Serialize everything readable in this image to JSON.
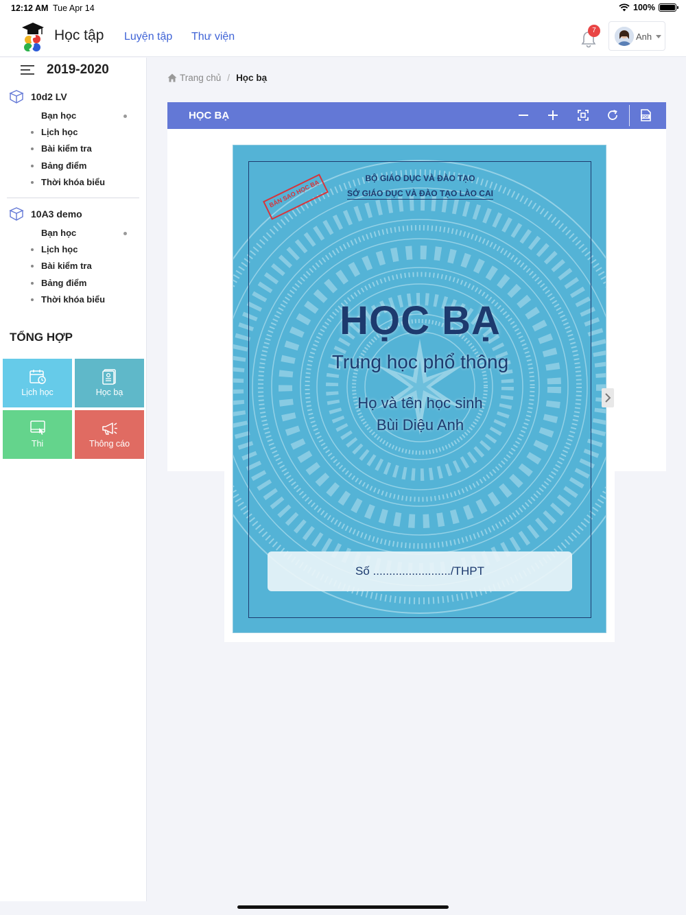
{
  "status_bar": {
    "time": "12:12 AM",
    "date": "Tue Apr 14",
    "battery": "100%"
  },
  "header": {
    "app_title": "Học tập",
    "nav": [
      "Luyện tập",
      "Thư viện"
    ],
    "notification_count": "7",
    "user_name": "Anh"
  },
  "sidebar": {
    "year": "2019-2020",
    "classes": [
      {
        "name": "10d2 LV",
        "items": [
          "Bạn học",
          "Lịch học",
          "Bài kiểm tra",
          "Bảng điểm",
          "Thời khóa biểu"
        ]
      },
      {
        "name": "10A3 demo",
        "items": [
          "Bạn học",
          "Lịch học",
          "Bài kiểm tra",
          "Bảng điểm",
          "Thời khóa biểu"
        ]
      }
    ],
    "summary_title": "TỔNG HỢP",
    "tiles": [
      {
        "label": "Lịch học",
        "color": "#66cbe9"
      },
      {
        "label": "Học bạ",
        "color": "#5fb8c9"
      },
      {
        "label": "Thi",
        "color": "#64d48c"
      },
      {
        "label": "Thông cáo",
        "color": "#e06b62"
      }
    ]
  },
  "breadcrumb": {
    "home": "Trang chủ",
    "current": "Học bạ"
  },
  "panel": {
    "title": "HỌC BẠ",
    "toolbar": [
      "zoom-out-icon",
      "zoom-in-icon",
      "fit-screen-icon",
      "rotate-icon",
      "pdf-icon"
    ]
  },
  "cover": {
    "ministry": "BỘ GIÁO DỤC VÀ ĐÀO TẠO",
    "department": "SỞ GIÁO DỤC VÀ ĐÀO TẠO LÀO CAI",
    "stamp": "BẢN SAO HỌC BẠ",
    "title": "HỌC BẠ",
    "subtitle": "Trung học phổ thông",
    "name_label": "Họ và tên học sinh",
    "student_name": "Bùi Diệu Anh",
    "number_line": "Số ......................../THPT",
    "colors": {
      "background": "#54b3d6",
      "ink": "#1d3a6e",
      "stamp": "#d8343a"
    }
  },
  "accent_color": "#6378d6"
}
